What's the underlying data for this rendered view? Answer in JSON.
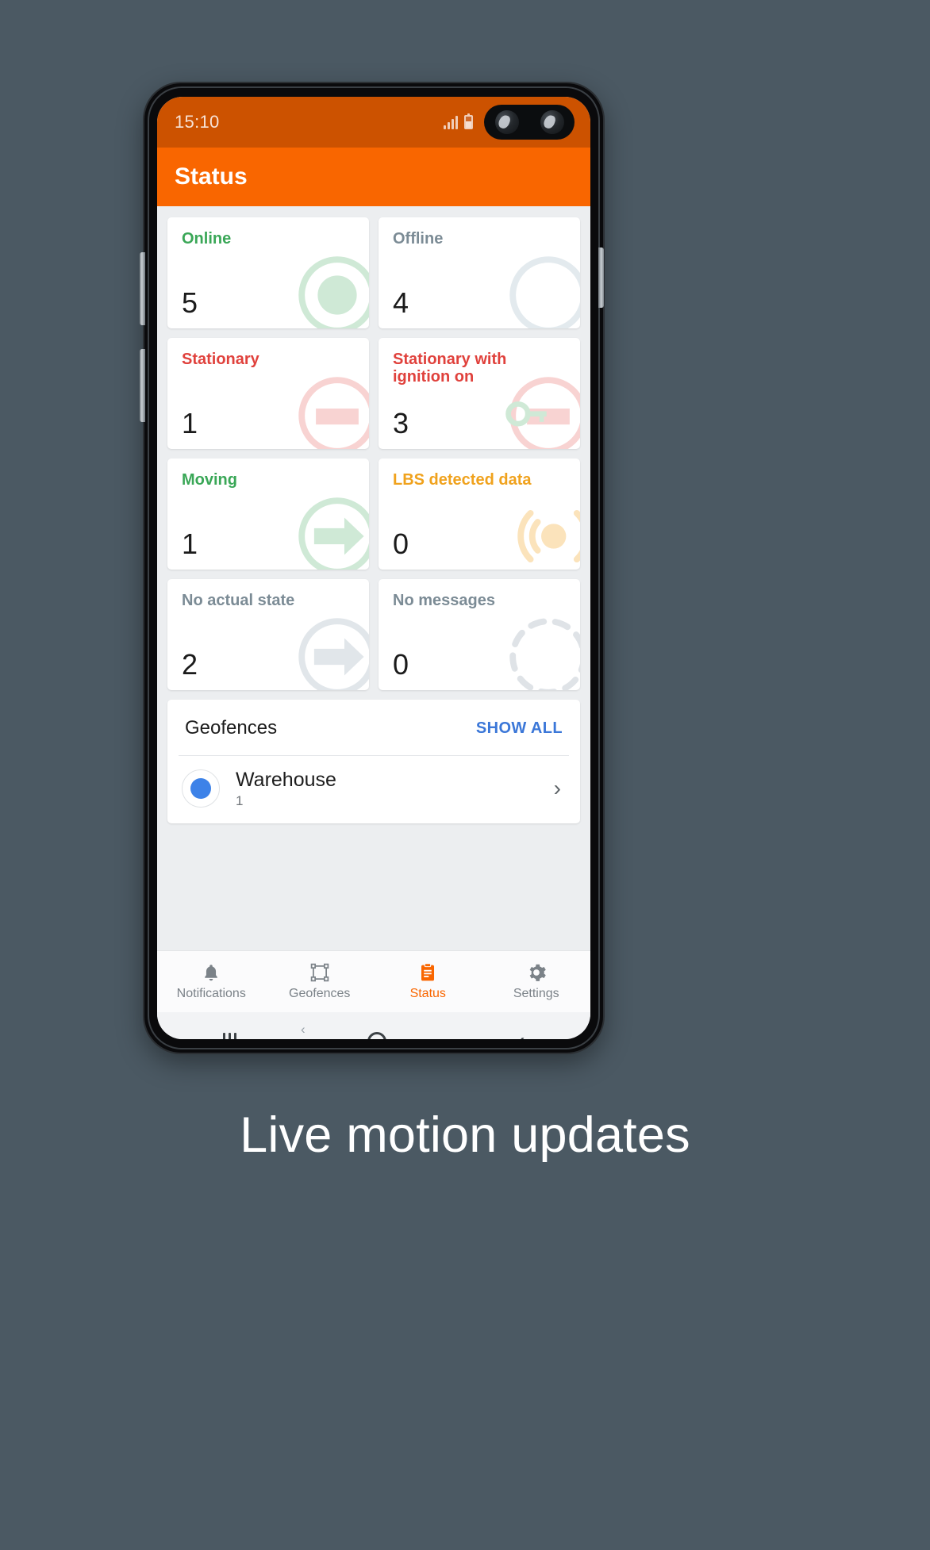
{
  "page": {
    "background_color": "#4b5963",
    "caption": "Live motion updates"
  },
  "status_bar": {
    "time": "15:10",
    "signal_icon": "signal-bars-icon",
    "battery_icon": "battery-icon",
    "camera_icon": "dual-camera-punchhole"
  },
  "app_bar": {
    "title": "Status",
    "background_color": "#f96600"
  },
  "stats": {
    "cards": [
      {
        "label": "Online",
        "value": "5",
        "color": "#3aa757",
        "watermark": "circle-dot-icon",
        "wm_color": "#cfe9d6"
      },
      {
        "label": "Offline",
        "value": "4",
        "color": "#7b8b95",
        "watermark": "circle-ring-icon",
        "wm_color": "#e3eaee"
      },
      {
        "label": "Stationary",
        "value": "1",
        "color": "#e0413c",
        "watermark": "circle-bar-icon",
        "wm_color": "#f8d3d2"
      },
      {
        "label": "Stationary with ignition on",
        "value": "3",
        "color": "#e0413c",
        "watermark": "ignition-key-icon",
        "wm_color": "#f8d3d2"
      },
      {
        "label": "Moving",
        "value": "1",
        "color": "#3aa757",
        "watermark": "circle-arrow-icon",
        "wm_color": "#cfe9d6"
      },
      {
        "label": "LBS detected data",
        "value": "0",
        "color": "#f0a21d",
        "watermark": "signal-waves-icon",
        "wm_color": "#fbe3bb"
      },
      {
        "label": "No actual state",
        "value": "2",
        "color": "#7b8b95",
        "watermark": "circle-arrow-icon",
        "wm_color": "#e1e6ea"
      },
      {
        "label": "No messages",
        "value": "0",
        "color": "#7b8b95",
        "watermark": "dashed-circle-icon",
        "wm_color": "#dfe3e7"
      }
    ]
  },
  "geofences": {
    "title": "Geofences",
    "show_all_label": "SHOW ALL",
    "show_all_color": "#3b77d8",
    "items": [
      {
        "name": "Warehouse",
        "count": "1",
        "dot_color": "#3d82e8",
        "chevron": "›"
      }
    ]
  },
  "bottom_nav": {
    "active_color": "#f96600",
    "items": [
      {
        "label": "Notifications",
        "icon": "bell-icon",
        "active": false
      },
      {
        "label": "Geofences",
        "icon": "polygon-icon",
        "active": false
      },
      {
        "label": "Status",
        "icon": "clipboard-icon",
        "active": true
      },
      {
        "label": "Settings",
        "icon": "gear-icon",
        "active": false
      }
    ]
  },
  "system_nav": {
    "recents_icon": "recents-icon",
    "home_icon": "home-icon",
    "back_icon": "back-icon"
  }
}
